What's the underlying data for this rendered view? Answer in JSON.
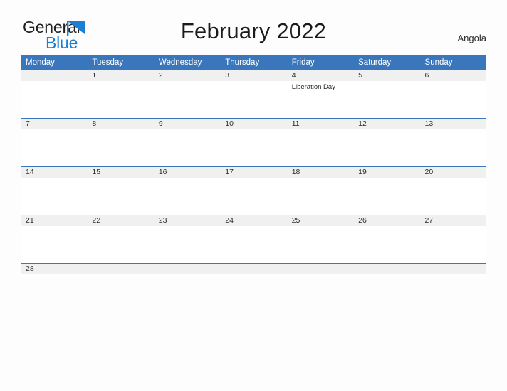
{
  "brand": {
    "name_part1": "General",
    "name_part2": "Blue",
    "flag_color": "#1c7fd4",
    "text_color": "#231f20"
  },
  "header": {
    "title": "February 2022",
    "country": "Angola",
    "accent_color": "#3a76bc",
    "band_color": "#f0f0f0"
  },
  "calendar": {
    "weekday_headers": [
      "Monday",
      "Tuesday",
      "Wednesday",
      "Thursday",
      "Friday",
      "Saturday",
      "Sunday"
    ],
    "weeks": [
      [
        {
          "day": "",
          "events": []
        },
        {
          "day": "1",
          "events": []
        },
        {
          "day": "2",
          "events": []
        },
        {
          "day": "3",
          "events": []
        },
        {
          "day": "4",
          "events": [
            "Liberation Day"
          ]
        },
        {
          "day": "5",
          "events": []
        },
        {
          "day": "6",
          "events": []
        }
      ],
      [
        {
          "day": "7",
          "events": []
        },
        {
          "day": "8",
          "events": []
        },
        {
          "day": "9",
          "events": []
        },
        {
          "day": "10",
          "events": []
        },
        {
          "day": "11",
          "events": []
        },
        {
          "day": "12",
          "events": []
        },
        {
          "day": "13",
          "events": []
        }
      ],
      [
        {
          "day": "14",
          "events": []
        },
        {
          "day": "15",
          "events": []
        },
        {
          "day": "16",
          "events": []
        },
        {
          "day": "17",
          "events": []
        },
        {
          "day": "18",
          "events": []
        },
        {
          "day": "19",
          "events": []
        },
        {
          "day": "20",
          "events": []
        }
      ],
      [
        {
          "day": "21",
          "events": []
        },
        {
          "day": "22",
          "events": []
        },
        {
          "day": "23",
          "events": []
        },
        {
          "day": "24",
          "events": []
        },
        {
          "day": "25",
          "events": []
        },
        {
          "day": "26",
          "events": []
        },
        {
          "day": "27",
          "events": []
        }
      ],
      [
        {
          "day": "28",
          "events": []
        },
        {
          "day": "",
          "events": []
        },
        {
          "day": "",
          "events": []
        },
        {
          "day": "",
          "events": []
        },
        {
          "day": "",
          "events": []
        },
        {
          "day": "",
          "events": []
        },
        {
          "day": "",
          "events": []
        }
      ]
    ]
  }
}
